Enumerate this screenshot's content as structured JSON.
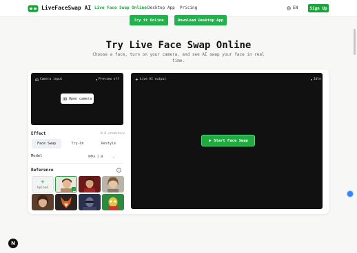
{
  "nav": {
    "brand": "LiveFaceSwap AI",
    "links": [
      "Live Face Swap Online",
      "Desktop App",
      "Pricing"
    ],
    "language": "EN",
    "signup": "Sign Up"
  },
  "cta": {
    "try_online": "Try it Online",
    "download": "Download Desktop App"
  },
  "hero": {
    "title": "Try Live Face Swap Online",
    "subtitle": "Choose a face, turn on your camera, and see AI swap your face in real time."
  },
  "camera": {
    "label": "Camera input",
    "preview_status": "Preview off",
    "open_button": "Open camera"
  },
  "effect": {
    "label": "Effect",
    "credits": "8.6 credits/s",
    "tabs": [
      "Face Swap",
      "Try-On",
      "Restyle"
    ],
    "active_tab": "Face Swap"
  },
  "model": {
    "label": "Model",
    "value": "XMAS 2.0"
  },
  "reference": {
    "label": "Reference",
    "upload": "Upload",
    "selected_index": 1
  },
  "output": {
    "label": "Live AI output",
    "status": "Idle",
    "start_button": "Start Face Swap"
  },
  "colors": {
    "brand_green": "#1aa33a",
    "panel_bg": "#111111"
  },
  "badge": "N"
}
